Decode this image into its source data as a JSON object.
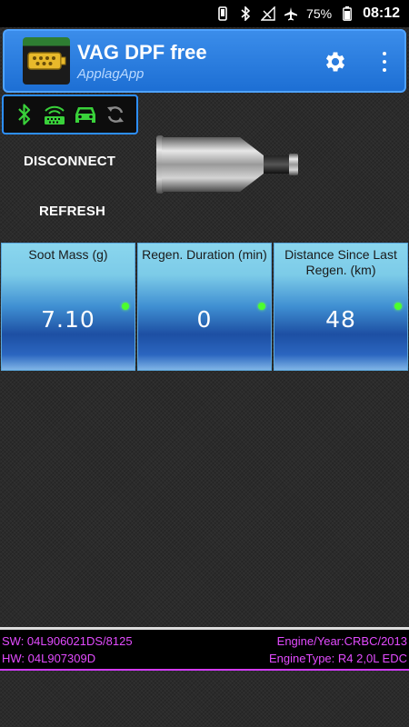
{
  "status_bar": {
    "battery": "75%",
    "time": "08:12",
    "icons": [
      "vibrate-icon",
      "bluetooth-icon",
      "no-signal-icon",
      "airplane-icon",
      "battery-icon"
    ]
  },
  "app_bar": {
    "title": "VAG DPF free",
    "subtitle": "ApplagApp",
    "icons": [
      "app-logo",
      "settings-icon",
      "more-vert-icon"
    ]
  },
  "connection_icons": [
    "bluetooth-icon",
    "obd-adapter-icon",
    "car-icon",
    "sync-icon"
  ],
  "actions": {
    "disconnect": "DISCONNECT",
    "refresh": "REFRESH"
  },
  "tiles": [
    {
      "label": "Soot Mass (g)",
      "value": "7.10"
    },
    {
      "label": "Regen. Duration (min)",
      "value": "0"
    },
    {
      "label": "Distance Since Last Regen. (km)",
      "value": "48"
    }
  ],
  "info": {
    "sw": "SW: 04L906021DS/8125",
    "engine_year": "Engine/Year:CRBC/2013",
    "hw": "HW: 04L907309D",
    "engine_type": "EngineType: R4 2,0L EDC"
  },
  "colors": {
    "app_bar": "#1d6fd4",
    "icon_green": "#39d13a",
    "info_text": "#e34bff",
    "status_dot": "#4cff2d"
  }
}
